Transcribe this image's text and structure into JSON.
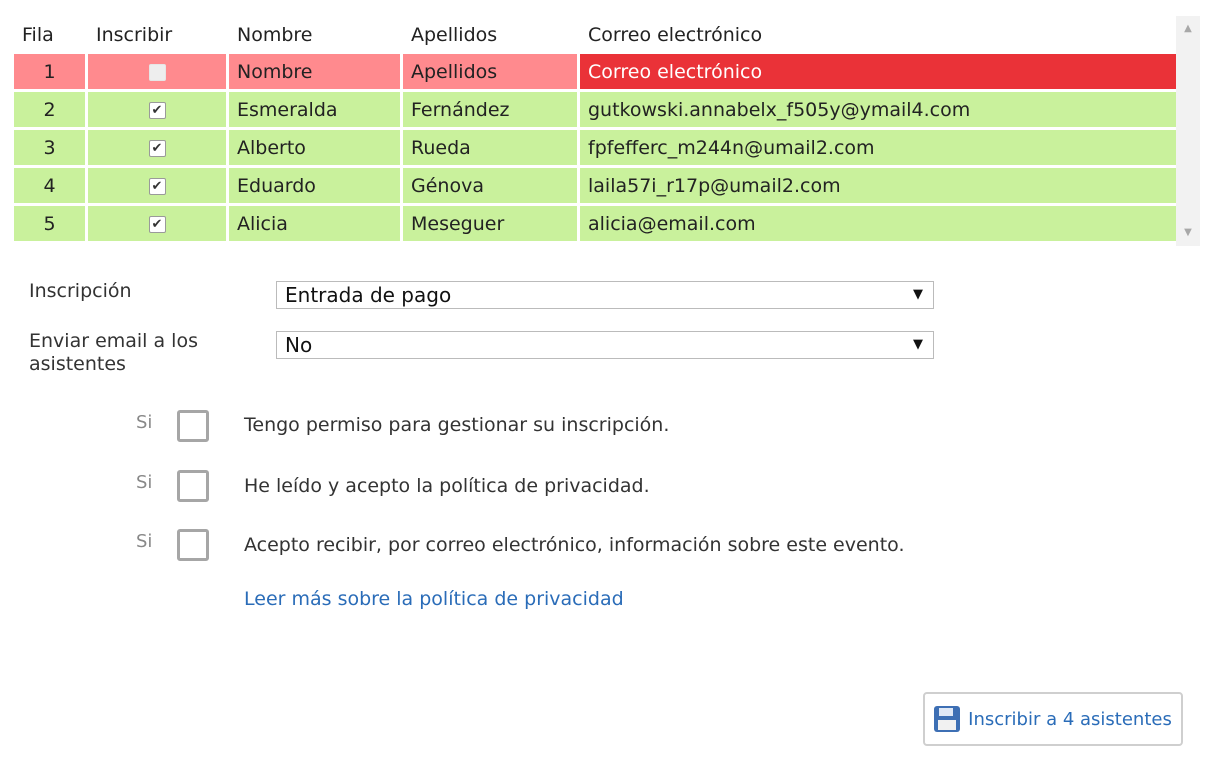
{
  "grid": {
    "headers": {
      "fila": "Fila",
      "inscribir": "Inscribir",
      "nombre": "Nombre",
      "apellidos": "Apellidos",
      "correo": "Correo electrónico"
    },
    "rows": [
      {
        "fila": "1",
        "checked": false,
        "nombre": "Nombre",
        "apellidos": "Apellidos",
        "correo": "Correo electrónico"
      },
      {
        "fila": "2",
        "checked": true,
        "check_glyph": "✔",
        "nombre": "Esmeralda",
        "apellidos": "Fernández",
        "correo": "gutkowski.annabelx_f505y@ymail4.com"
      },
      {
        "fila": "3",
        "checked": true,
        "check_glyph": "✔",
        "nombre": "Alberto",
        "apellidos": "Rueda",
        "correo": "fpfefferc_m244n@umail2.com"
      },
      {
        "fila": "4",
        "checked": true,
        "check_glyph": "✔",
        "nombre": "Eduardo",
        "apellidos": "Génova",
        "correo": "laila57i_r17p@umail2.com"
      },
      {
        "fila": "5",
        "checked": true,
        "check_glyph": "✔",
        "nombre": "Alicia",
        "apellidos": "Meseguer",
        "correo": "alicia@email.com"
      }
    ],
    "colors": {
      "ok_row": "#c9f19c",
      "error_row": "#ff8a8e",
      "error_cell": "#ea3238"
    }
  },
  "form": {
    "inscripcion_label": "Inscripción",
    "inscripcion_value": "Entrada de pago",
    "email_label_line1": "Enviar email a los",
    "email_label_line2": "asistentes",
    "email_value": "No",
    "dropdown_arrow": "▼"
  },
  "consents": [
    {
      "si": "Si",
      "text": "Tengo permiso para gestionar su inscripción."
    },
    {
      "si": "Si",
      "text": "He leído y acepto la política de privacidad."
    },
    {
      "si": "Si",
      "text": "Acepto recibir, por correo electrónico, información sobre este evento."
    }
  ],
  "privacy_link": "Leer más sobre la política de privacidad",
  "submit": {
    "label": "Inscribir a 4 asistentes",
    "icon": "floppy-disk-icon"
  }
}
